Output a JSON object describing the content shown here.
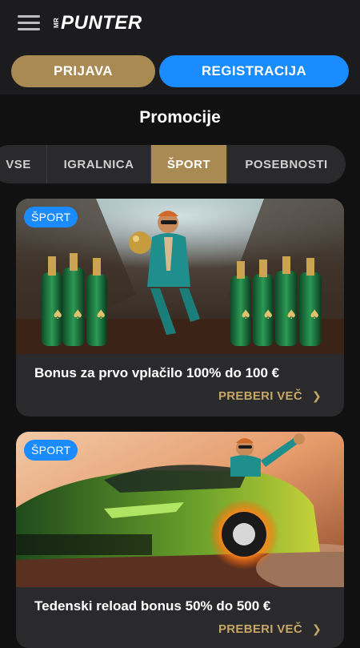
{
  "header": {
    "logo_prefix": "MR",
    "logo_word": "PUNTER",
    "login_label": "PRIJAVA",
    "register_label": "REGISTRACIJA"
  },
  "page_title": "Promocije",
  "tabs": [
    {
      "label": "VSE",
      "active": false
    },
    {
      "label": "IGRALNICA",
      "active": false
    },
    {
      "label": "ŠPORT",
      "active": true
    },
    {
      "label": "POSEBNOSTI",
      "active": false
    }
  ],
  "promotions": [
    {
      "badge": "ŠPORT",
      "title": "Bonus za prvo vplačilo 100% do 100 €",
      "link_label": "PREBERI VEČ"
    },
    {
      "badge": "ŠPORT",
      "title": "Tedenski reload bonus 50% do 500 €",
      "link_label": "PREBERI VEČ"
    }
  ],
  "colors": {
    "gold": "#a88a52",
    "blue": "#1a8cff",
    "background": "#111112"
  },
  "icons": {
    "menu": "hamburger-menu-icon",
    "chevron": "chevron-right-icon"
  }
}
